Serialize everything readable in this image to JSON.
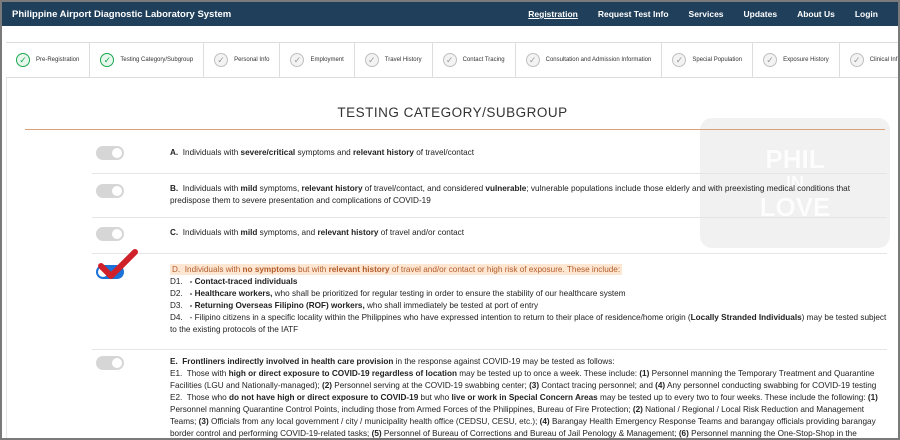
{
  "nav": {
    "brand": "Philippine Airport Diagnostic Laboratory System",
    "links": [
      "Registration",
      "Request Test Info",
      "Services",
      "Updates",
      "About Us",
      "Login"
    ]
  },
  "steps": [
    {
      "label": "Pre-Registration",
      "done": true
    },
    {
      "label": "Testing Category/Subgroup",
      "done": true
    },
    {
      "label": "Personal Info",
      "done": false
    },
    {
      "label": "Employment",
      "done": false
    },
    {
      "label": "Travel History",
      "done": false
    },
    {
      "label": "Contact Tracing",
      "done": false
    },
    {
      "label": "Consultation and Admission Information",
      "done": false
    },
    {
      "label": "Special Population",
      "done": false
    },
    {
      "label": "Exposure History",
      "done": false
    },
    {
      "label": "Clinical Inf",
      "done": false
    }
  ],
  "page": {
    "title": "TESTING CATEGORY/SUBGROUP"
  },
  "watermark": [
    "PHIL",
    "IN",
    "LOVE"
  ],
  "categories": [
    {
      "letter": "A.",
      "text_html": "Individuals with <b>severe/critical</b> symptoms and <b>relevant history</b> of travel/contact",
      "selected": false
    },
    {
      "letter": "B.",
      "text_html": "Individuals with <b>mild</b> symptoms, <b>relevant history</b> of travel/contact, and considered <b>vulnerable</b>; vulnerable populations include those elderly and with preexisting medical conditions that predispose them to severe presentation and complications of COVID-19",
      "selected": false
    },
    {
      "letter": "C.",
      "text_html": "Individuals with <b>mild</b> symptoms, and <b>relevant history</b> of travel and/or contact",
      "selected": false
    },
    {
      "letter": "D.",
      "text_html": "<span class='hl'>D.&nbsp; Individuals with <b>no symptoms</b> but with <b>relevant history</b> of travel and/or contact or high risk of exposure. These include:</span><br>D1.&nbsp;&nbsp; <b>- Contact-traced individuals</b><br>D2.&nbsp;&nbsp; <b>- Healthcare workers,</b> who shall be prioritized for regular testing in order to ensure the stability of our healthcare system<br>D3.&nbsp;&nbsp; <b>- Returning Overseas Filipino (ROF) workers,</b> who shall immediately be tested at port of entry<br>D4.&nbsp;&nbsp; - Filipino citizens in a specific locality within the Philippines who have expressed intention to return to their place of residence/home origin (<b>Locally Stranded Individuals</b>) may be tested subject to the existing protocols of the IATF",
      "selected": true
    },
    {
      "letter": "E.",
      "text_html": "<b>E.&nbsp; Frontliners indirectly involved in health care provision</b> in the response against COVID-19 may be tested as follows:<br>E1.&nbsp; Those with <b>high or direct exposure to COVID-19 regardless of location</b> may be tested up to once a week. These include: <b>(1)</b> Personnel manning the Temporary Treatment and Quarantine Facilities (LGU and Nationally-managed); <b>(2)</b> Personnel serving at the COVID-19 swabbing center; <b>(3)</b> Contact tracing personnel; and <b>(4)</b> Any personnel conducting swabbing for COVID-19 testing<br>E2.&nbsp; Those who <b>do not have high or direct exposure to COVID-19</b> but who <b>live or work in Special Concern Areas</b> may be tested up to every two to four weeks. These include the following: <b>(1)</b> Personnel manning Quarantine Control Points, including those from Armed Forces of the Philippines, Bureau of Fire Protection; <b>(2)</b> National / Regional / Local Risk Reduction and Management Teams; <b>(3)</b> Officials from any local government / city / municipality health office (CEDSU, CESU, etc.); <b>(4)</b> Barangay Health Emergency Response Teams and barangay officials providing barangay border control and performing COVID-19-related tasks; <b>(5)</b> Personnel of Bureau of Corrections and Bureau of Jail Penology &amp; Management; <b>(6)</b> Personnel manning the One-Stop-Shop in the",
      "selected": false
    }
  ]
}
